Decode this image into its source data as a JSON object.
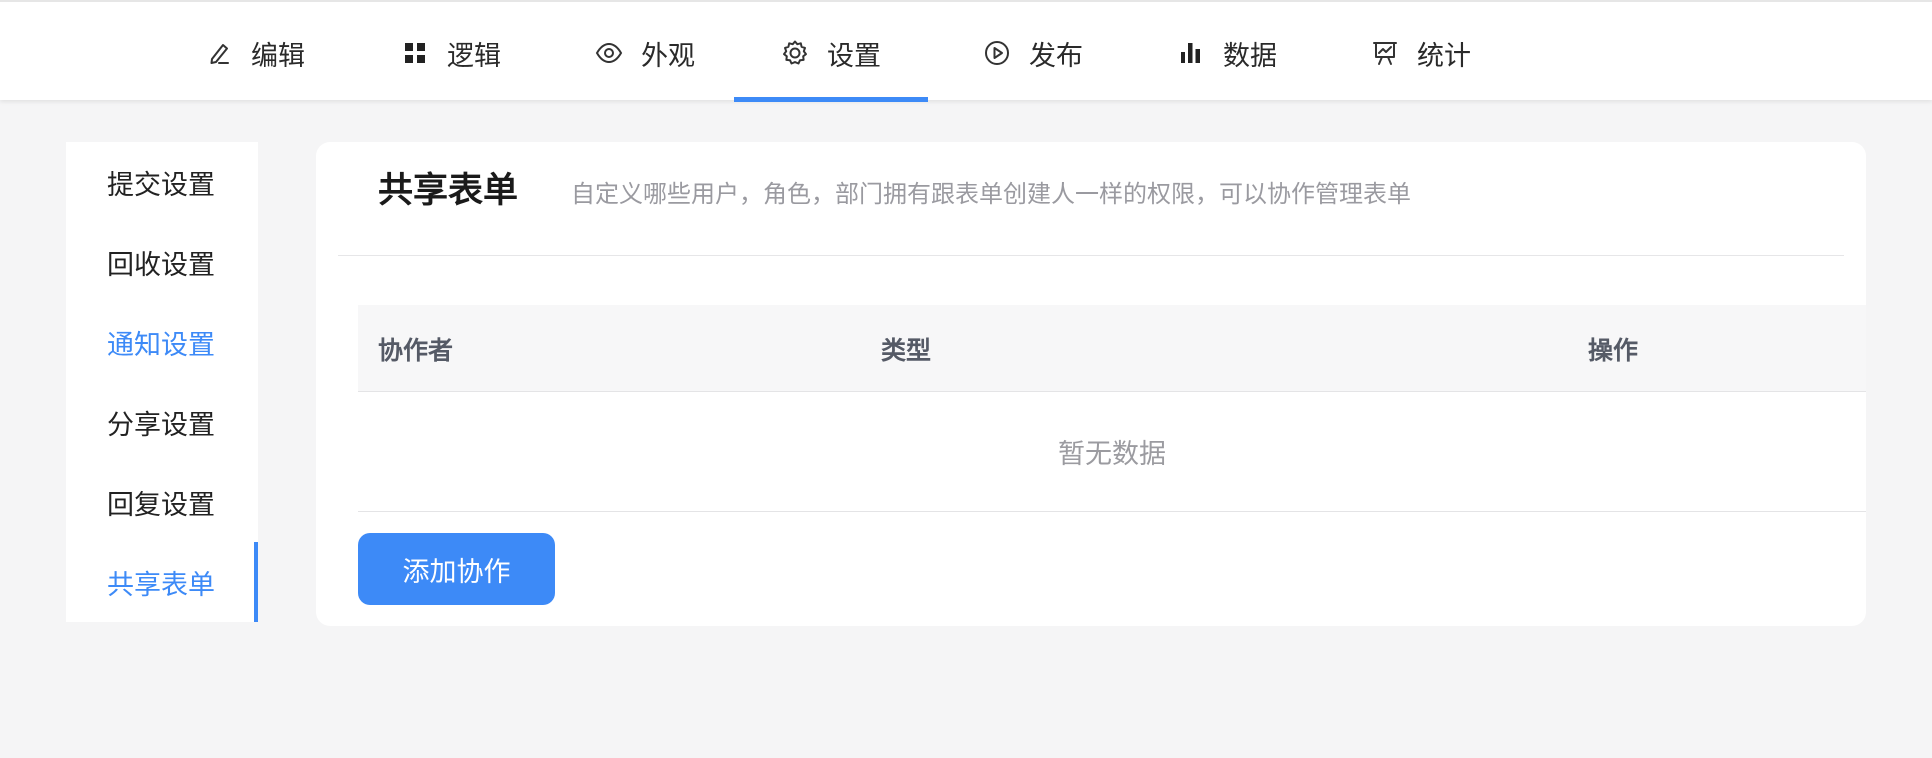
{
  "top_tabs": [
    {
      "label": "编辑",
      "icon": "edit-icon"
    },
    {
      "label": "逻辑",
      "icon": "grid-icon"
    },
    {
      "label": "外观",
      "icon": "eye-icon"
    },
    {
      "label": "设置",
      "icon": "gear-icon",
      "active": true
    },
    {
      "label": "发布",
      "icon": "play-circle-icon"
    },
    {
      "label": "数据",
      "icon": "bar-chart-icon"
    },
    {
      "label": "统计",
      "icon": "presentation-chart-icon"
    }
  ],
  "sidebar": {
    "items": [
      {
        "label": "提交设置"
      },
      {
        "label": "回收设置"
      },
      {
        "label": "通知设置",
        "highlight": true
      },
      {
        "label": "分享设置"
      },
      {
        "label": "回复设置"
      },
      {
        "label": "共享表单",
        "active": true
      }
    ]
  },
  "main": {
    "title": "共享表单",
    "description": "自定义哪些用户，角色，部门拥有跟表单创建人一样的权限，可以协作管理表单",
    "table": {
      "columns": [
        "协作者",
        "类型",
        "操作"
      ],
      "empty_text": "暂无数据"
    },
    "add_button": "添加协作"
  },
  "colors": {
    "accent": "#3d8af7",
    "text": "#222222",
    "muted": "#9a9aa0",
    "background": "#f5f5f6"
  }
}
